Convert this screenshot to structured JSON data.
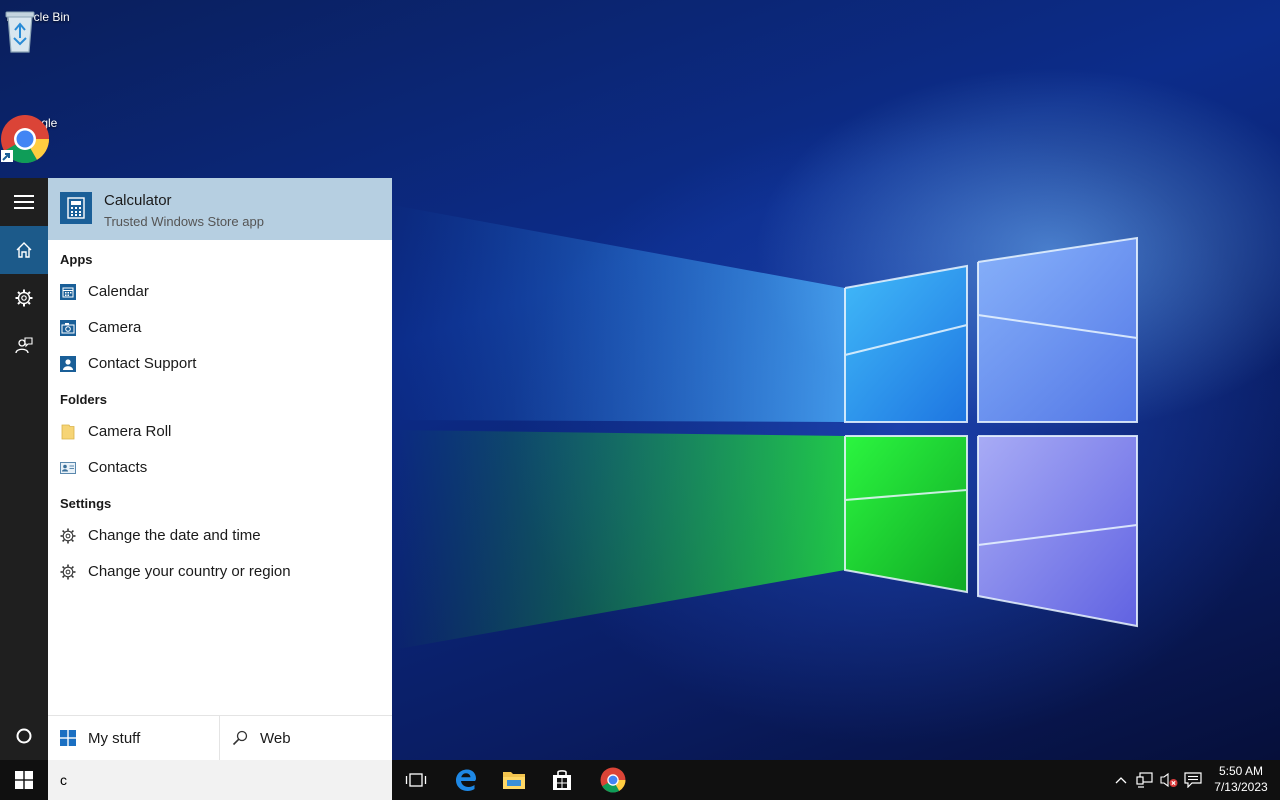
{
  "desktop": {
    "icons": [
      {
        "label": "Recycle Bin",
        "icon": "recycle-bin-icon"
      },
      {
        "label": "Google",
        "icon": "chrome-icon"
      }
    ]
  },
  "start_rail": {
    "items": [
      "hamburger-menu-icon",
      "home-icon",
      "settings-icon",
      "feedback-icon",
      "cortana-circle-icon"
    ]
  },
  "search_results": {
    "best_match": {
      "title": "Calculator",
      "subtitle": "Trusted Windows Store app",
      "icon": "calculator-icon"
    },
    "sections": [
      {
        "heading": "Apps",
        "items": [
          {
            "label": "Calendar",
            "icon": "calendar-icon"
          },
          {
            "label": "Camera",
            "icon": "camera-icon"
          },
          {
            "label": "Contact Support",
            "icon": "contact-support-icon"
          }
        ]
      },
      {
        "heading": "Folders",
        "items": [
          {
            "label": "Camera Roll",
            "icon": "folder-icon"
          },
          {
            "label": "Contacts",
            "icon": "contacts-card-icon"
          }
        ]
      },
      {
        "heading": "Settings",
        "items": [
          {
            "label": "Change the date and time",
            "icon": "gear-icon"
          },
          {
            "label": "Change your country or region",
            "icon": "gear-icon"
          }
        ]
      }
    ],
    "scopes": {
      "my_stuff": "My stuff",
      "web": "Web"
    }
  },
  "taskbar": {
    "search_value": "c",
    "pinned": [
      "task-view-icon",
      "edge-icon",
      "file-explorer-icon",
      "store-icon",
      "chrome-icon"
    ],
    "tray": [
      "chevron-up-icon",
      "network-icon",
      "volume-muted-icon",
      "action-center-icon"
    ],
    "clock": {
      "time": "5:50 AM",
      "date": "7/13/2023"
    }
  },
  "colors": {
    "accent": "#1a5f98",
    "best_match_bg": "#b6cfe1",
    "taskbar": "#101010",
    "rail": "#1f1f1f"
  }
}
